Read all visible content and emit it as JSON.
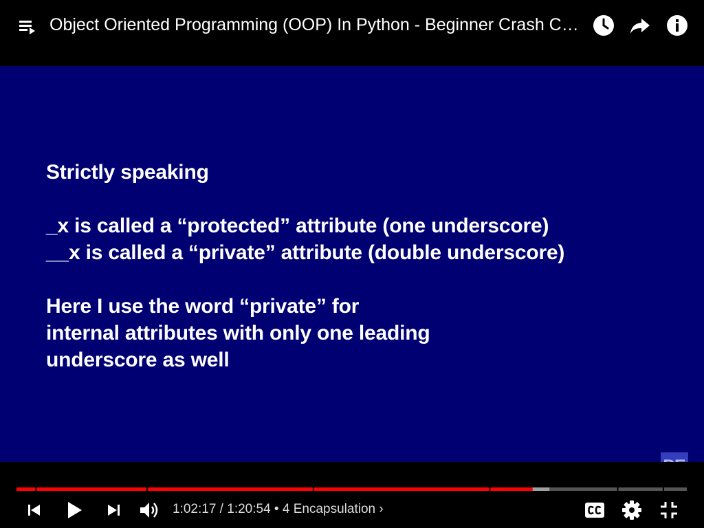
{
  "header": {
    "title": "Object Oriented Programming (OOP) In Python - Beginner Crash Course"
  },
  "slide": {
    "lines": [
      "Strictly speaking",
      "",
      "_x is called a “protected” attribute (one underscore)",
      "__x is called a “private” attribute (double underscore)",
      "",
      "Here I use the word “private” for",
      "internal attributes with only one leading",
      "underscore as well"
    ],
    "logo": "PE"
  },
  "controls": {
    "current_time": "1:02:17",
    "time_separator": " / ",
    "duration": "1:20:54",
    "chapter_separator": " • ",
    "chapter": "4 Encapsulation",
    "chapter_chevron": "›",
    "progress_fraction": 0.77,
    "buffered_fraction": 0.795
  },
  "colors": {
    "slide_background": "#000072",
    "progress_played": "#ff0000",
    "progress_buffered": "#a0a0a0",
    "progress_track": "#555555"
  },
  "icons": {
    "playlist": "playlist-icon",
    "watch_later": "clock-icon",
    "share": "share-arrow-icon",
    "info": "info-icon",
    "previous": "skip-previous-icon",
    "play": "play-icon",
    "next": "skip-next-icon",
    "volume": "volume-icon",
    "captions": "cc-icon",
    "settings": "gear-icon",
    "exit_fullscreen": "exit-fullscreen-icon"
  }
}
